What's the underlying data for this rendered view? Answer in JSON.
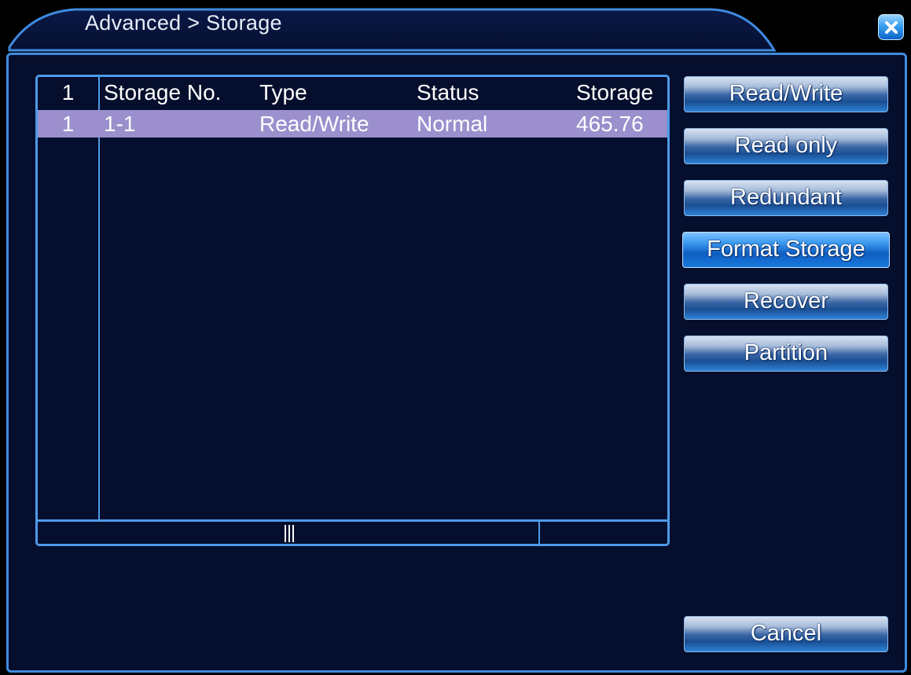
{
  "window": {
    "title": "Advanced > Storage",
    "close_icon": "close-icon",
    "accent_color": "#3f8be0",
    "background_color": "#050e2c"
  },
  "table": {
    "columns": [
      "1",
      "Storage No.",
      "Type",
      "Status",
      "Storage"
    ],
    "rows": [
      {
        "index": "1",
        "storage_no": "1-1",
        "type": "Read/Write",
        "status": "Normal",
        "storage": "465.76"
      }
    ],
    "selected_row_color": "#9b8fcd"
  },
  "actions": {
    "read_write": "Read/Write",
    "read_only": "Read only",
    "redundant": "Redundant",
    "format_storage": "Format Storage",
    "recover": "Recover",
    "partition": "Partition",
    "cancel": "Cancel"
  }
}
